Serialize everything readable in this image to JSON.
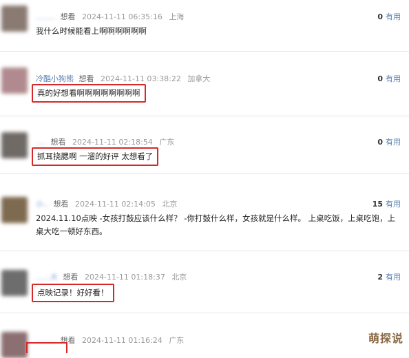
{
  "useful_label": "有用",
  "comments": [
    {
      "user": "........",
      "action": "想看",
      "time": "2024-11-11 06:35:16",
      "location": "上海",
      "useful": "0",
      "text": "我什么时候能看上啊啊啊啊啊啊",
      "avatar_color": "#8a7b72"
    },
    {
      "user": "冷酷小狗熊",
      "action": "想看",
      "time": "2024-11-11 03:38:22",
      "location": "加拿大",
      "useful": "0",
      "text": "真的好想看啊啊啊啊啊啊啊啊",
      "avatar_color": "#b08a8e"
    },
    {
      "user": "....",
      "action": "想看",
      "time": "2024-11-11 02:18:54",
      "location": "广东",
      "useful": "0",
      "text": "抓耳挠腮啊 一溜的好评 太想看了",
      "avatar_color": "#6f6a66"
    },
    {
      "user": "小..",
      "action": "想看",
      "time": "2024-11-11 02:14:05",
      "location": "北京",
      "useful": "15",
      "text": "2024.11.10点映 -女孩打鼓应该什么样？ -你打鼓什么样，女孩就是什么样。 上桌吃饭，上桌吃饱，上桌大吃一顿好东西。",
      "avatar_color": "#7e6a4e"
    },
    {
      "user": "......大",
      "action": "想看",
      "time": "2024-11-11 01:18:37",
      "location": "北京",
      "useful": "2",
      "text": "点映记录！好好看！",
      "avatar_color": "#6d6d6d"
    },
    {
      "user": "........",
      "action": "想看",
      "time": "2024-11-11 01:16:24",
      "location": "广东",
      "useful": "",
      "text": "",
      "avatar_color": "#8c6f70"
    }
  ],
  "watermark": "萌探说"
}
